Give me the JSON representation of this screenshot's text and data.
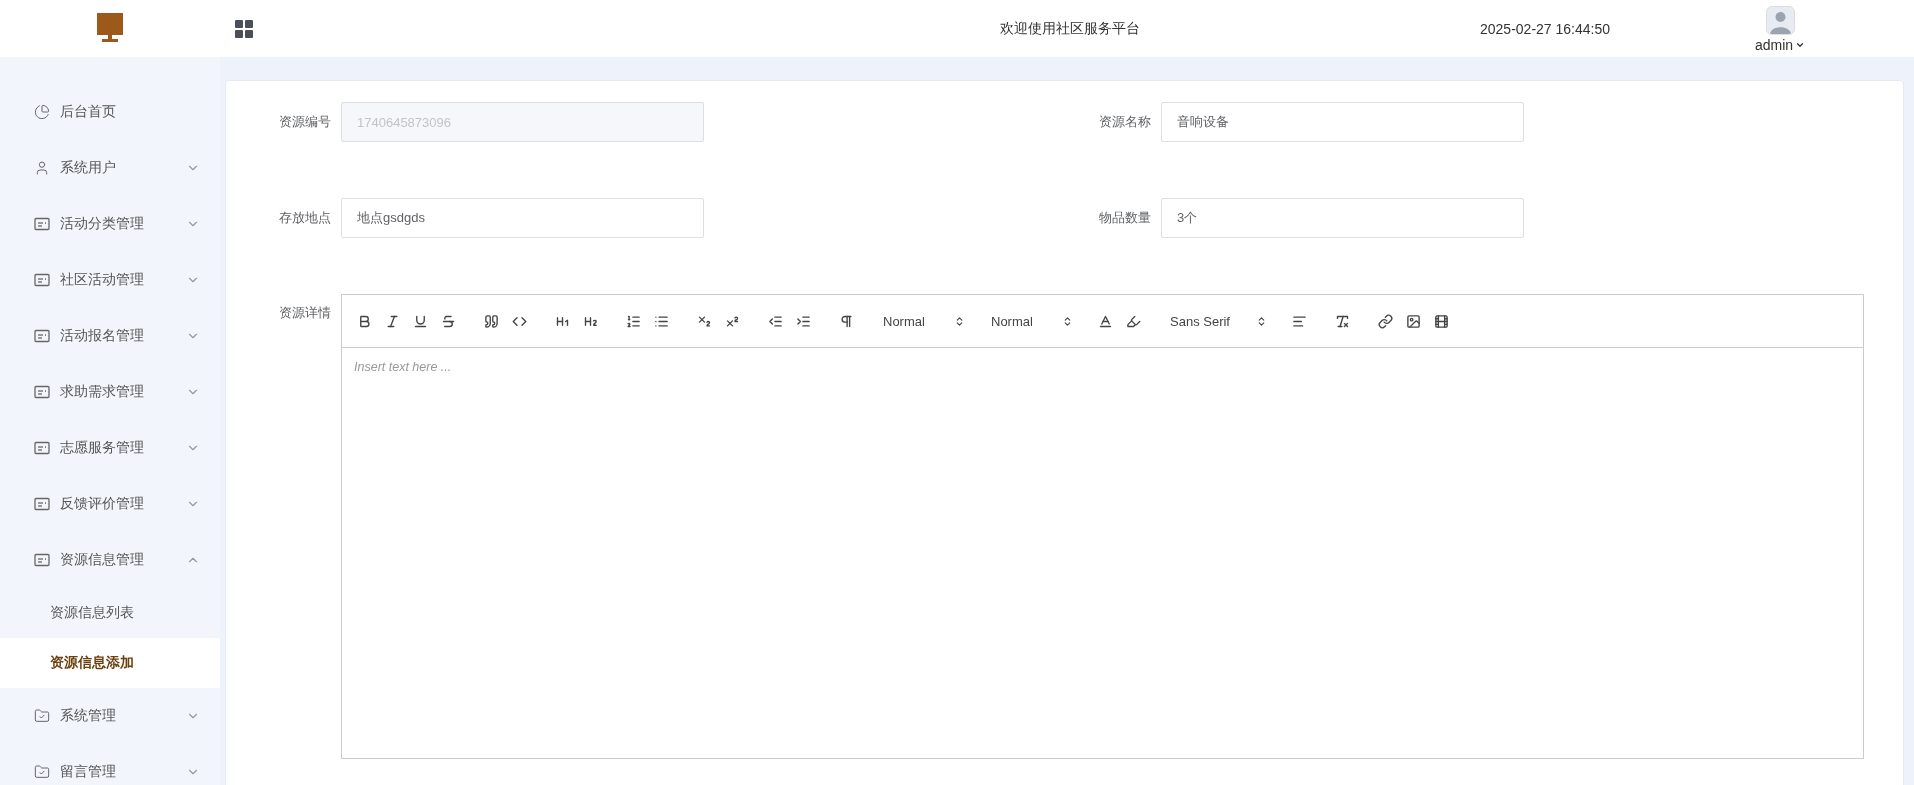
{
  "header": {
    "title": "欢迎使用社区服务平台",
    "datetime": "2025-02-27 16:44:50",
    "user": "admin"
  },
  "sidebar": {
    "items": [
      {
        "label": "后台首页"
      },
      {
        "label": "系统用户",
        "expanded": false
      },
      {
        "label": "活动分类管理",
        "expanded": false
      },
      {
        "label": "社区活动管理",
        "expanded": false
      },
      {
        "label": "活动报名管理",
        "expanded": false
      },
      {
        "label": "求助需求管理",
        "expanded": false
      },
      {
        "label": "志愿服务管理",
        "expanded": false
      },
      {
        "label": "反馈评价管理",
        "expanded": false
      },
      {
        "label": "资源信息管理",
        "expanded": true,
        "children": [
          {
            "label": "资源信息列表",
            "selected": false
          },
          {
            "label": "资源信息添加",
            "selected": true
          }
        ]
      },
      {
        "label": "系统管理",
        "expanded": false
      },
      {
        "label": "留言管理",
        "expanded": false
      }
    ]
  },
  "form": {
    "fields": [
      {
        "label": "资源编号",
        "value": "1740645873096",
        "disabled": true
      },
      {
        "label": "资源名称",
        "value": "音响设备",
        "disabled": false
      },
      {
        "label": "存放地点",
        "value": "地点gsdgds",
        "disabled": false
      },
      {
        "label": "物品数量",
        "value": "3个",
        "disabled": false
      }
    ],
    "editor": {
      "label": "资源详情",
      "pickers": [
        "Normal",
        "Normal",
        "Sans Serif"
      ],
      "placeholder": "Insert text here ..."
    }
  }
}
